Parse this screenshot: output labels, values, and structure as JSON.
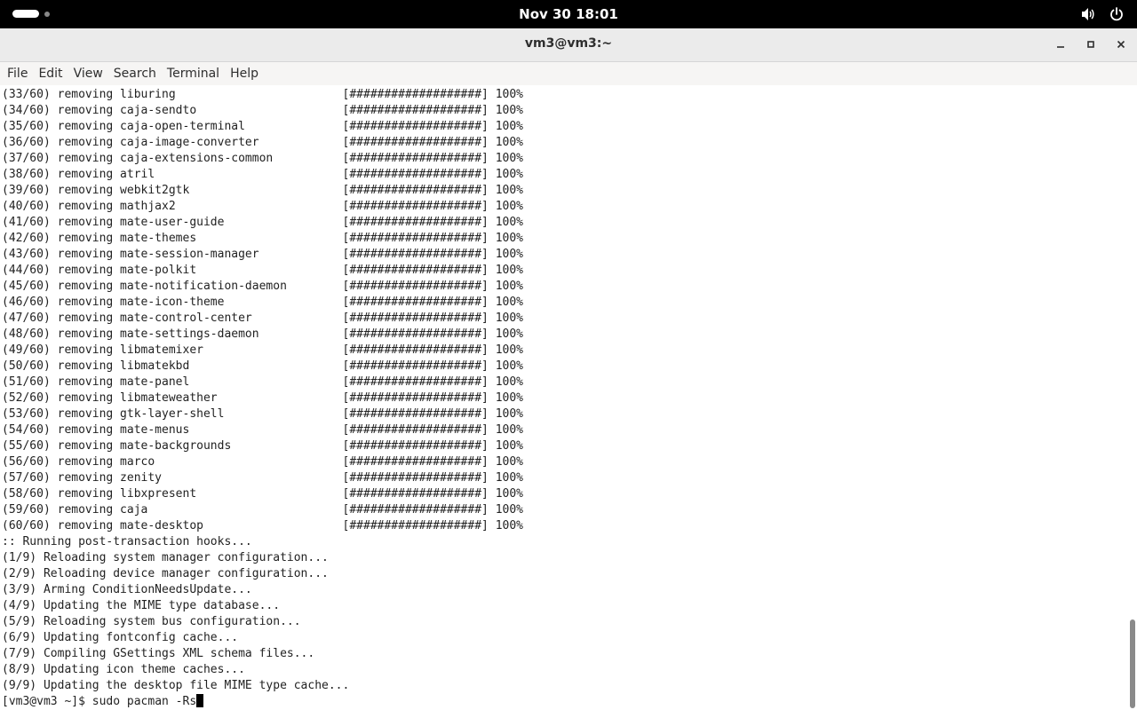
{
  "topbar": {
    "clock": "Nov 30  18:01",
    "icons": [
      "activities-indicator",
      "volume-icon",
      "power-icon"
    ]
  },
  "window": {
    "title": "vm3@vm3:~",
    "buttons": [
      "minimize-icon",
      "maximize-icon",
      "close-icon"
    ]
  },
  "menubar": {
    "items": [
      "File",
      "Edit",
      "View",
      "Search",
      "Terminal",
      "Help"
    ]
  },
  "terminal": {
    "lines": [
      "(33/60) removing liburing                        [###################] 100%",
      "(34/60) removing caja-sendto                     [###################] 100%",
      "(35/60) removing caja-open-terminal              [###################] 100%",
      "(36/60) removing caja-image-converter            [###################] 100%",
      "(37/60) removing caja-extensions-common          [###################] 100%",
      "(38/60) removing atril                           [###################] 100%",
      "(39/60) removing webkit2gtk                      [###################] 100%",
      "(40/60) removing mathjax2                        [###################] 100%",
      "(41/60) removing mate-user-guide                 [###################] 100%",
      "(42/60) removing mate-themes                     [###################] 100%",
      "(43/60) removing mate-session-manager            [###################] 100%",
      "(44/60) removing mate-polkit                     [###################] 100%",
      "(45/60) removing mate-notification-daemon        [###################] 100%",
      "(46/60) removing mate-icon-theme                 [###################] 100%",
      "(47/60) removing mate-control-center             [###################] 100%",
      "(48/60) removing mate-settings-daemon            [###################] 100%",
      "(49/60) removing libmatemixer                    [###################] 100%",
      "(50/60) removing libmatekbd                      [###################] 100%",
      "(51/60) removing mate-panel                      [###################] 100%",
      "(52/60) removing libmateweather                  [###################] 100%",
      "(53/60) removing gtk-layer-shell                 [###################] 100%",
      "(54/60) removing mate-menus                      [###################] 100%",
      "(55/60) removing mate-backgrounds                [###################] 100%",
      "(56/60) removing marco                           [###################] 100%",
      "(57/60) removing zenity                          [###################] 100%",
      "(58/60) removing libxpresent                     [###################] 100%",
      "(59/60) removing caja                            [###################] 100%",
      "(60/60) removing mate-desktop                    [###################] 100%",
      ":: Running post-transaction hooks...",
      "(1/9) Reloading system manager configuration...",
      "(2/9) Reloading device manager configuration...",
      "(3/9) Arming ConditionNeedsUpdate...",
      "(4/9) Updating the MIME type database...",
      "(5/9) Reloading system bus configuration...",
      "(6/9) Updating fontconfig cache...",
      "(7/9) Compiling GSettings XML schema files...",
      "(8/9) Updating icon theme caches...",
      "(9/9) Updating the desktop file MIME type cache..."
    ],
    "prompt": "[vm3@vm3 ~]$ ",
    "command": "sudo pacman -Rs"
  },
  "colors": {
    "topbar_bg": "#000000",
    "titlebar_bg": "#ebebeb",
    "terminal_bg": "#ffffff",
    "terminal_fg": "#222222"
  }
}
